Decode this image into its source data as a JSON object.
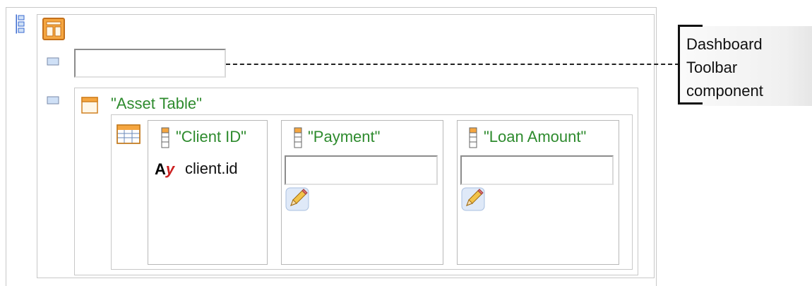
{
  "callout": {
    "text": "Dashboard\nToolbar\ncomponent"
  },
  "asset_table": {
    "title": "\"Asset Table\"",
    "columns": [
      {
        "header": "\"Client ID\"",
        "value": "client.id",
        "value_icon": "text-type-icon",
        "value_icon_text_a": "A",
        "value_icon_text_y": "y"
      },
      {
        "header": "\"Payment\"",
        "edit_icon": "pencil-icon"
      },
      {
        "header": "\"Loan Amount\"",
        "edit_icon": "pencil-icon"
      }
    ]
  },
  "colors": {
    "label_green": "#2e8b2e",
    "border_gray": "#c8c8c8",
    "icon_orange": "#e8902a"
  }
}
